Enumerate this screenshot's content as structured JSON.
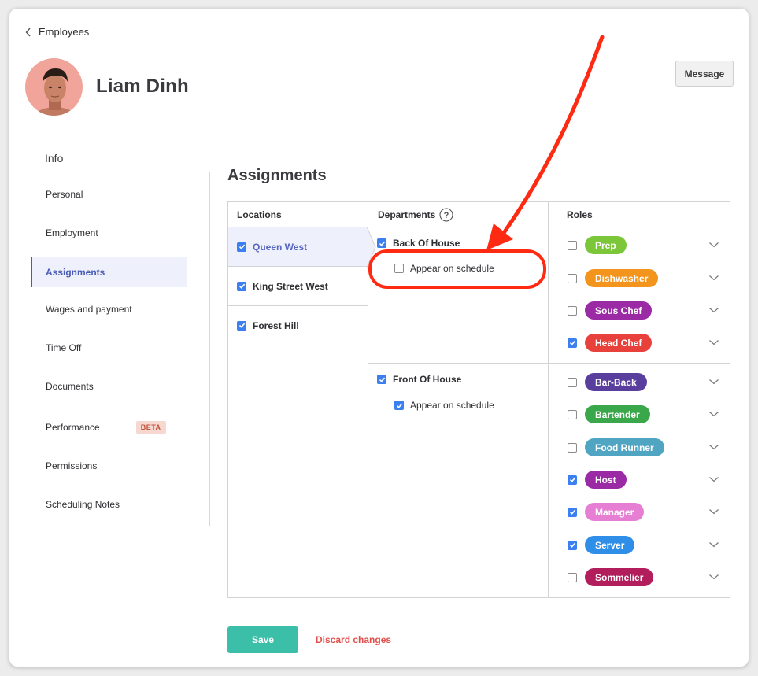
{
  "breadcrumb": {
    "label": "Employees"
  },
  "employee": {
    "name": "Liam Dinh"
  },
  "header": {
    "message_label": "Message"
  },
  "sidebar": {
    "title": "Info",
    "items": [
      {
        "label": "Personal"
      },
      {
        "label": "Employment"
      },
      {
        "label": "Assignments",
        "active": true
      },
      {
        "label": "Wages and payment"
      },
      {
        "label": "Time Off"
      },
      {
        "label": "Documents"
      },
      {
        "label": "Performance",
        "badge": "BETA"
      },
      {
        "label": "Permissions"
      },
      {
        "label": "Scheduling Notes"
      }
    ]
  },
  "assignments": {
    "title": "Assignments",
    "columns": {
      "locations": "Locations",
      "departments": "Departments",
      "roles": "Roles"
    },
    "locations": [
      {
        "label": "Queen West",
        "checked": true,
        "selected": true
      },
      {
        "label": "King Street West",
        "checked": true
      },
      {
        "label": "Forest Hill",
        "checked": true
      }
    ],
    "departments": [
      {
        "label": "Back Of House",
        "checked": true,
        "appear_label": "Appear on schedule",
        "appear_checked": false,
        "roles": [
          {
            "label": "Prep",
            "checked": false,
            "color": "#7cc63a"
          },
          {
            "label": "Dishwasher",
            "checked": false,
            "color": "#f3941c"
          },
          {
            "label": "Sous Chef",
            "checked": false,
            "color": "#9b2aa5"
          },
          {
            "label": "Head Chef",
            "checked": true,
            "color": "#e8413c"
          }
        ]
      },
      {
        "label": "Front Of House",
        "checked": true,
        "appear_label": "Appear on schedule",
        "appear_checked": true,
        "roles": [
          {
            "label": "Bar-Back",
            "checked": false,
            "color": "#5a3e9e"
          },
          {
            "label": "Bartender",
            "checked": false,
            "color": "#3aa84a"
          },
          {
            "label": "Food Runner",
            "checked": false,
            "color": "#4fa5c2"
          },
          {
            "label": "Host",
            "checked": true,
            "color": "#9b2aa5"
          },
          {
            "label": "Manager",
            "checked": true,
            "color": "#e67fd3"
          },
          {
            "label": "Server",
            "checked": true,
            "color": "#2f8ee8"
          },
          {
            "label": "Sommelier",
            "checked": false,
            "color": "#b21d5c"
          }
        ]
      }
    ]
  },
  "footer": {
    "save_label": "Save",
    "discard_label": "Discard changes"
  },
  "annotation": {
    "color": "#ff2a12"
  }
}
